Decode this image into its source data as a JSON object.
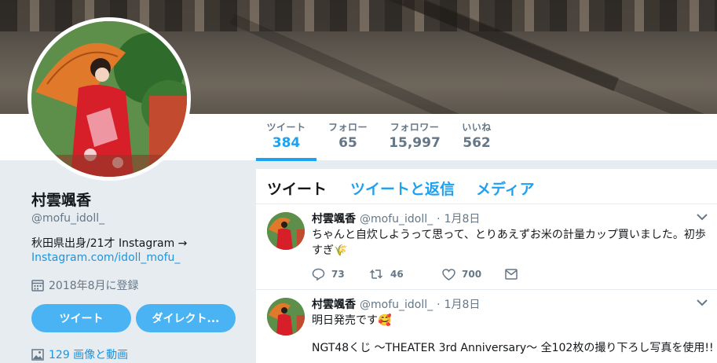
{
  "profile": {
    "name": "村雲颯香",
    "handle": "@mofu_idoll_",
    "bio": "秋田県出身/21才 Instagram →",
    "bio_link": "Instagram.com/idoll_mofu_",
    "joined": "2018年8月に登録",
    "tweet_button": "ツイート",
    "dm_button": "ダイレクト...",
    "media_link": "129 画像と動画"
  },
  "stats": {
    "tweets_label": "ツイート",
    "tweets_value": "384",
    "following_label": "フォロー",
    "following_value": "65",
    "followers_label": "フォロワー",
    "followers_value": "15,997",
    "likes_label": "いいね",
    "likes_value": "562"
  },
  "tabs": {
    "tweets": "ツイート",
    "replies": "ツイートと返信",
    "media": "メディア"
  },
  "tweets": [
    {
      "name": "村雲颯香",
      "handle": "@mofu_idoll_",
      "dot": "·",
      "time": "1月8日",
      "text": "ちゃんと自炊しようって思って、とりあえずお米の計量カップ買いました。初歩すぎ🌾",
      "replies": "73",
      "retweets": "46",
      "likes": "700"
    },
    {
      "name": "村雲颯香",
      "handle": "@mofu_idoll_",
      "dot": "·",
      "time": "1月8日",
      "text": "明日発売です🥰",
      "text2": "NGT48くじ 〜THEATER 3rd Anniversary〜 全102枚の撮り下ろし写真を使用!!"
    }
  ],
  "colors": {
    "accent": "#1da1f2",
    "button": "#4ab3f4",
    "muted": "#657786",
    "bg": "#e6ecf0"
  }
}
